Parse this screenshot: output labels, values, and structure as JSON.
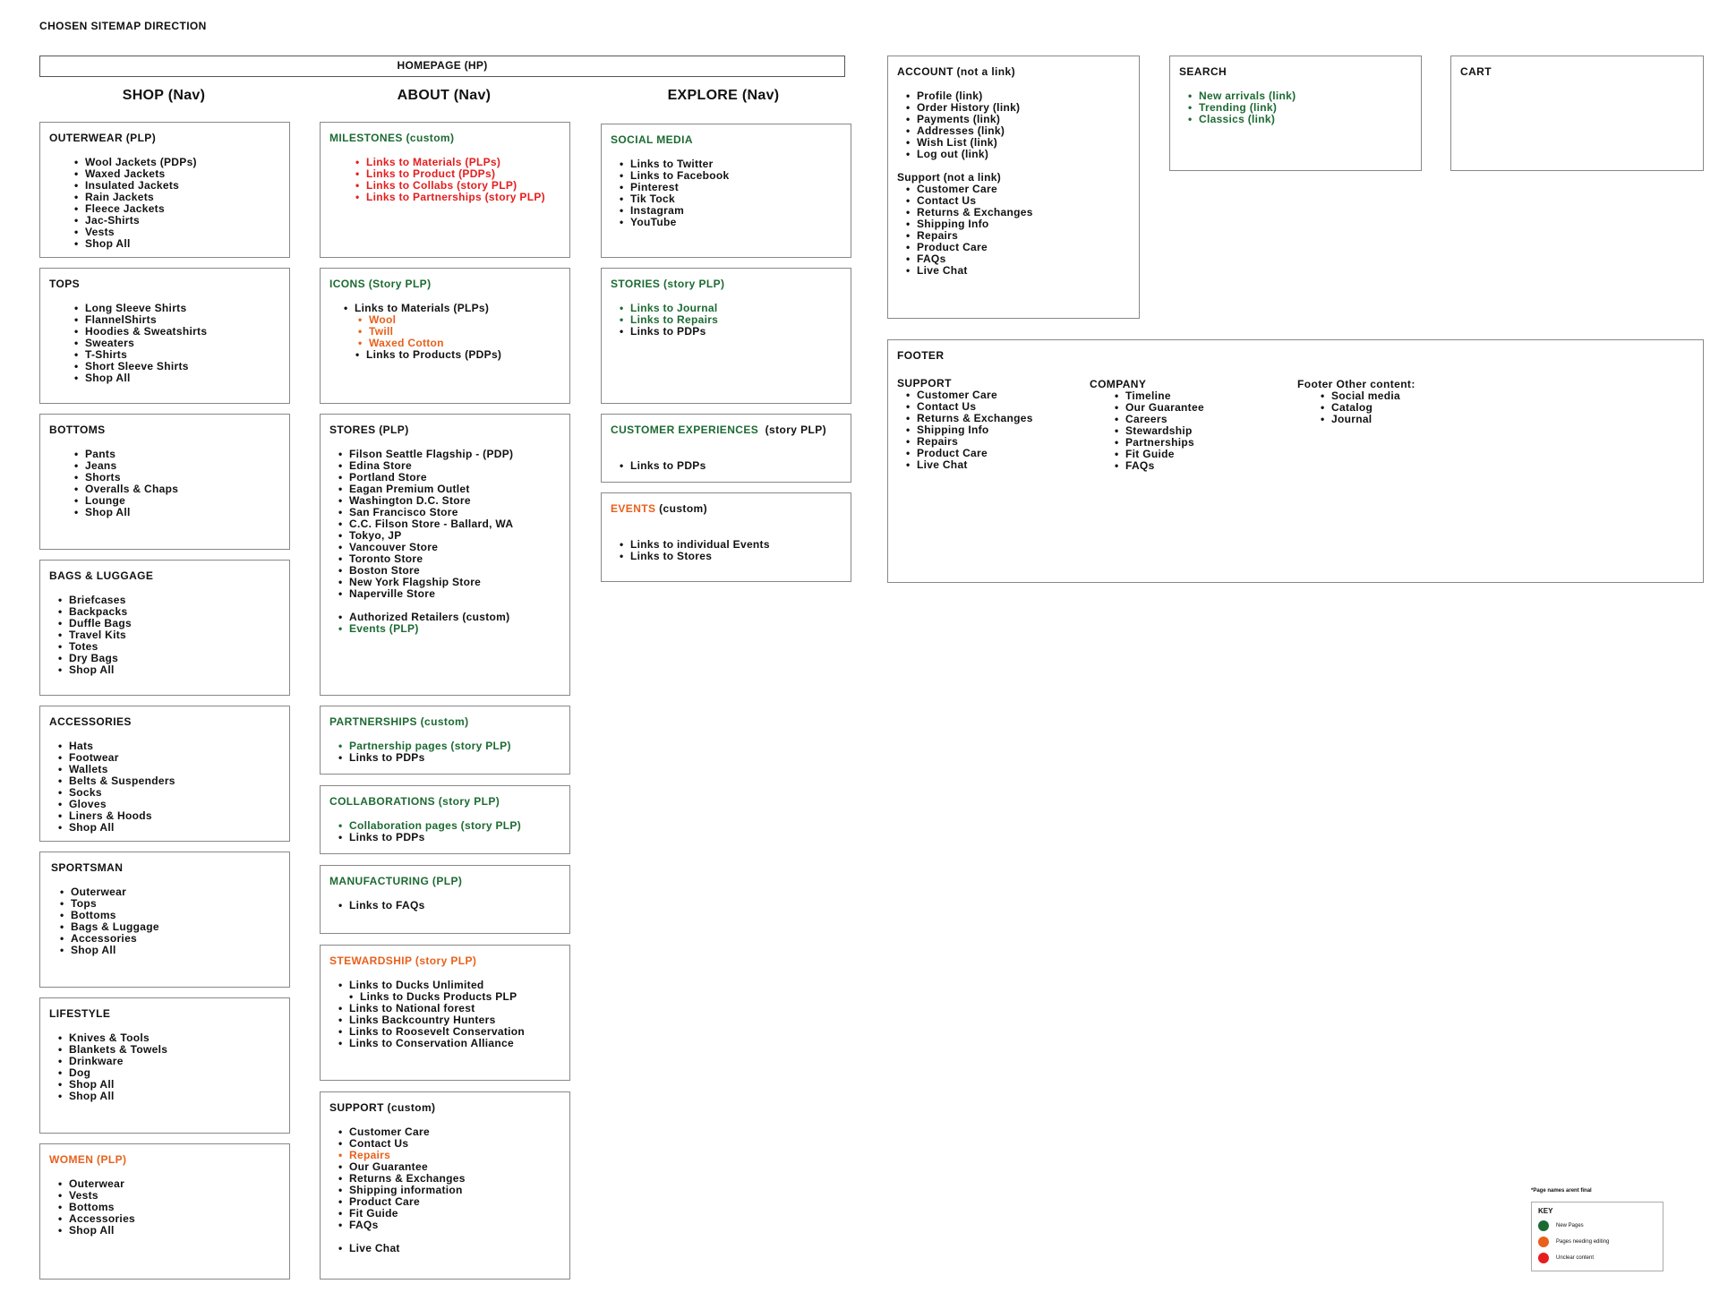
{
  "page_title": "CHOSEN SITEMAP DIRECTION",
  "homepage_label": "HOMEPAGE (HP)",
  "columns": {
    "shop": "SHOP (Nav)",
    "about": "ABOUT (Nav)",
    "explore": "EXPLORE (Nav)"
  },
  "shop": {
    "outerwear": {
      "title": "OUTERWEAR (PLP)",
      "items": [
        "Wool Jackets (PDPs)",
        "Waxed Jackets",
        "Insulated Jackets",
        "Rain Jackets",
        "Fleece Jackets",
        "Jac-Shirts",
        "Vests",
        "Shop All"
      ]
    },
    "tops": {
      "title": "TOPS",
      "items": [
        "Long Sleeve Shirts",
        "FlannelShirts",
        "Hoodies & Sweatshirts",
        "Sweaters",
        "T-Shirts",
        "Short Sleeve Shirts",
        "Shop All"
      ]
    },
    "bottoms": {
      "title": "BOTTOMS",
      "items": [
        "Pants",
        "Jeans",
        "Shorts",
        "Overalls & Chaps",
        "Lounge",
        "Shop All"
      ]
    },
    "bags": {
      "title": "BAGS & LUGGAGE",
      "items": [
        "Briefcases",
        "Backpacks",
        "Duffle Bags",
        "Travel Kits",
        "Totes",
        "Dry Bags",
        "Shop All"
      ]
    },
    "accessories": {
      "title": "ACCESSORIES",
      "items": [
        "Hats",
        "Footwear",
        "Wallets",
        "Belts & Suspenders",
        "Socks",
        "Gloves",
        "Liners & Hoods",
        "Shop All"
      ]
    },
    "sportsman": {
      "title": "SPORTSMAN",
      "items": [
        "Outerwear",
        "Tops",
        "Bottoms",
        "Bags & Luggage",
        "Accessories",
        "Shop All"
      ]
    },
    "lifestyle": {
      "title": "LIFESTYLE",
      "items": [
        "Knives & Tools",
        "Blankets & Towels",
        "Drinkware",
        "Dog",
        "Shop All",
        "Shop All"
      ]
    },
    "women": {
      "title": "WOMEN (PLP)",
      "items": [
        "Outerwear",
        "Vests",
        "Bottoms",
        "Accessories",
        "Shop All"
      ]
    }
  },
  "about": {
    "milestones": {
      "title": "MILESTONES (custom)",
      "items": [
        "Links to Materials (PLPs)",
        "Links to Product (PDPs)",
        "Links to Collabs (story PLP)",
        "Links to Partnerships (story PLP)"
      ]
    },
    "icons": {
      "title": "ICONS (Story PLP)",
      "item1": "Links to Materials (PLPs)",
      "subitems": [
        "Wool",
        "Twill",
        "Waxed Cotton"
      ],
      "item2": "Links to Products (PDPs)"
    },
    "stores": {
      "title": "STORES (PLP)",
      "items": [
        "Filson Seattle Flagship - (PDP)",
        "Edina Store",
        "Portland Store",
        "Eagan Premium Outlet",
        "Washington D.C. Store",
        "San Francisco Store",
        "C.C. Filson Store - Ballard, WA",
        "Tokyo, JP",
        "Vancouver Store",
        "Toronto Store",
        "Boston Store",
        "New York Flagship Store",
        "Naperville Store"
      ],
      "retailers": "Authorized Retailers (custom)",
      "events": "Events (PLP)"
    },
    "partnerships": {
      "title": "PARTNERSHIPS (custom)",
      "item1": "Partnership pages (story PLP)",
      "item2": "Links to PDPs"
    },
    "collaborations": {
      "title": "COLLABORATIONS (story PLP)",
      "item1": "Collaboration pages (story PLP)",
      "item2": "Links to PDPs"
    },
    "manufacturing": {
      "title": "MANUFACTURING (PLP)",
      "item1": "Links to FAQs"
    },
    "stewardship": {
      "title": "STEWARDSHIP (story PLP)",
      "item1": "Links to Ducks Unlimited",
      "sub1": "Links to Ducks Products PLP",
      "items": [
        "Links to National forest",
        "Links Backcountry Hunters",
        "Links to Roosevelt Conservation",
        "Links to Conservation Alliance"
      ]
    },
    "support": {
      "title": "SUPPORT (custom)",
      "item1": "Customer Care",
      "item2": "Contact Us",
      "repairs": "Repairs",
      "items": [
        "Our Guarantee",
        "Returns & Exchanges",
        "Shipping information",
        "Product Care",
        "Fit Guide",
        "FAQs"
      ],
      "live_chat": "Live Chat"
    }
  },
  "explore": {
    "social": {
      "title": "SOCIAL MEDIA",
      "items": [
        "Links to Twitter",
        "Links to Facebook",
        "Pinterest",
        "Tik Tock",
        "Instagram",
        "YouTube"
      ]
    },
    "stories": {
      "title": "STORIES (story PLP)",
      "item1": "Links to Journal",
      "item2": "Links to Repairs",
      "item3": "Links to PDPs"
    },
    "customer_exp": {
      "title": "CUSTOMER EXPERIENCES",
      "title_suffix": "(story PLP)",
      "item1": "Links to PDPs"
    },
    "events": {
      "title": "EVENTS",
      "title_suffix": "(custom)",
      "items": [
        "Links to individual Events",
        "Links to Stores"
      ]
    }
  },
  "account": {
    "title": "ACCOUNT (not a link)",
    "items": [
      "Profile (link)",
      "Order History (link)",
      "Payments (link)",
      "Addresses (link)",
      "Wish List (link)",
      "Log out (link)"
    ],
    "support_head": "Support (not a link)",
    "support_items": [
      "Customer Care",
      "Contact Us",
      "Returns & Exchanges",
      "Shipping Info",
      "Repairs",
      "Product Care",
      "FAQs",
      "Live Chat"
    ]
  },
  "search": {
    "title": "SEARCH",
    "items": [
      "New arrivals (link)",
      "Trending (link)",
      "Classics (link)"
    ]
  },
  "cart": {
    "title": "CART"
  },
  "footer": {
    "title": "FOOTER",
    "support": {
      "title": "SUPPORT",
      "items": [
        "Customer Care",
        "Contact Us",
        "Returns & Exchanges",
        "Shipping Info",
        "Repairs",
        "Product Care",
        "Live Chat"
      ]
    },
    "company": {
      "title": "COMPANY",
      "items": [
        "Timeline",
        "Our Guarantee",
        "Careers",
        "Stewardship",
        "Partnerships",
        "Fit Guide",
        "FAQs"
      ]
    },
    "other": {
      "title": "Footer Other content:",
      "items": [
        "Social media",
        "Catalog",
        "Journal"
      ]
    }
  },
  "key": {
    "note": "*Page names arent final",
    "title": "KEY",
    "rows": [
      {
        "label": "New Pages",
        "color": "#1c6a32"
      },
      {
        "label": "Pages needing editing",
        "color": "#e8601c"
      },
      {
        "label": "Unclear content",
        "color": "#e61d1d"
      }
    ]
  },
  "colors": {
    "new_pages": "#1c6a32",
    "needs_editing": "#e8601c",
    "unclear": "#e61d1d"
  }
}
